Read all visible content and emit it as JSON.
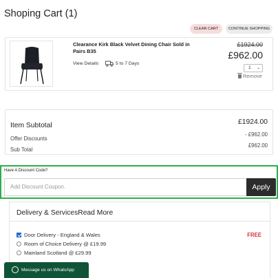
{
  "header": {
    "title": "Shoping Cart (1)"
  },
  "actions": {
    "clear_cart": "CLEAR CART",
    "continue_shopping": "CONTINUE SHOPPING"
  },
  "item": {
    "name": "Clearance Kirk Black Velvet Dining Chair Sold in Pairs B35",
    "view_details": "View Details",
    "delivery_time": "5 to 7 Days",
    "old_price": "£1924.00",
    "price": "£962.00",
    "quantity": "1",
    "remove": "Remove"
  },
  "summary": {
    "item_subtotal_label": "Item Subtotal",
    "item_subtotal_value": "£1924.00",
    "offer_discounts_label": "Offer Discounts",
    "offer_discounts_value": "- £962.00",
    "sub_total_label": "Sub Total",
    "sub_total_value": "£962.00"
  },
  "coupon": {
    "label": "Have A Discount Code?",
    "placeholder": "Add Discount Coupon.",
    "apply": "Apply",
    "highlight_color": "#2dae4a"
  },
  "delivery": {
    "heading": "Delivery & Services",
    "read_more": "Read More",
    "options": [
      {
        "label": "Door Delivery - England & Wales",
        "selected": true,
        "price": "FREE"
      },
      {
        "label": "Room of Choice Delivery @ £19.99",
        "selected": false
      },
      {
        "label": "Mainland Scotland @ £29.99",
        "selected": false
      }
    ]
  },
  "whatsapp": {
    "label": "Message us on WhatsApp",
    "icon": "whatsapp-icon"
  }
}
